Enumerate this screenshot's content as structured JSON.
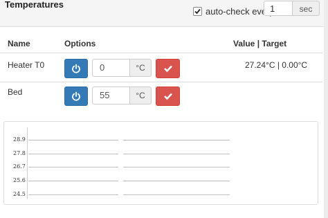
{
  "header": {
    "title": "Temperatures",
    "autocheck": {
      "label": "auto-check every:",
      "checked": true,
      "value": "1",
      "unit": "sec"
    }
  },
  "table": {
    "columns": {
      "name": "Name",
      "options": "Options",
      "value": "Value | Target"
    },
    "rows": [
      {
        "name": "Heater T0",
        "input_value": "0",
        "unit": "°C",
        "value_text": "27.24°C | 0.00°C"
      },
      {
        "name": "Bed",
        "input_value": "55",
        "unit": "°C",
        "value_text": ""
      }
    ]
  },
  "icons": {
    "power": "power-icon",
    "set": "checkmark-icon",
    "checkbox": "checkmark-icon"
  },
  "colors": {
    "primary": "#337ab7",
    "danger": "#d9534f",
    "header_bg": "#f5f5f5"
  },
  "chart_data": {
    "type": "line",
    "y_ticks": [
      "28.9",
      "27.8",
      "26.7",
      "25.6",
      "24.5"
    ],
    "ylim": [
      24.5,
      28.9
    ],
    "series": [],
    "grid": true
  }
}
